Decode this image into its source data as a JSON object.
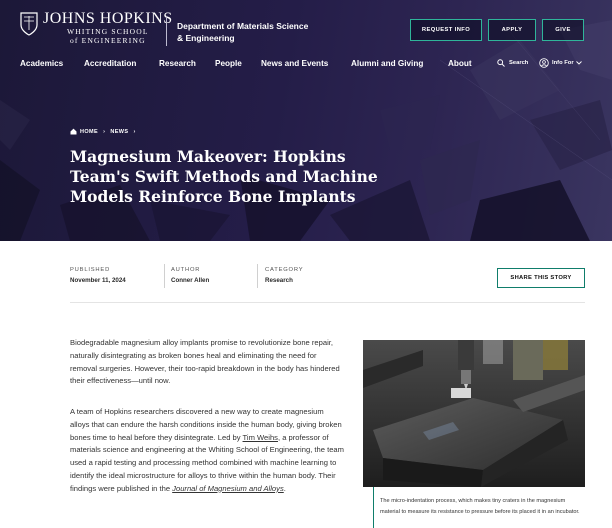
{
  "header": {
    "logo_main": "JOHNS HOPKINS",
    "logo_sub1": "WHITING SCHOOL",
    "logo_sub2": "of ENGINEERING",
    "dept_line1": "Department of Materials Science",
    "dept_line2": "& Engineering",
    "buttons": {
      "request": "REQUEST INFO",
      "apply": "APPLY",
      "give": "GIVE"
    }
  },
  "nav": {
    "items": [
      "Academics",
      "Accreditation",
      "Research",
      "People",
      "News and Events",
      "Alumni and Giving",
      "About"
    ],
    "search": "Search",
    "info_for": "Info For"
  },
  "breadcrumb": {
    "home": "HOME",
    "news": "NEWS"
  },
  "article": {
    "title": "Magnesium Makeover: Hopkins Team's Swift Methods and Machine Models Reinforce Bone Implants",
    "meta": {
      "published_label": "PUBLISHED",
      "published_value": "November 11, 2024",
      "author_label": "AUTHOR",
      "author_value": "Conner Allen",
      "category_label": "CATEGORY",
      "category_value": "Research"
    },
    "share": "SHARE THIS STORY",
    "para1": "Biodegradable magnesium alloy implants promise to revolutionize bone repair, naturally disintegrating as broken bones heal and eliminating the need for removal surgeries. However, their too-rapid breakdown in the body has hindered their effectiveness—until now.",
    "para2_a": "A team of Hopkins researchers discovered a new way to create magnesium alloys that can endure the harsh conditions inside the human body, giving broken bones time to heal before they disintegrate. Led by ",
    "para2_link": "Tim Weihs",
    "para2_b": ", a professor of materials science and engineering at the Whiting School of Engineering, the team used a rapid testing and processing method combined with machine learning to identify the ideal microstructure for alloys to thrive within the human body.  Their findings were published in the ",
    "para2_journal": "Journal of Magnesium and Alloys",
    "para2_end": ".",
    "caption": "The micro-indentation process, which makes tiny craters in the magnesium material to measure its resistance to pressure before its placed it in an incubator."
  },
  "colors": {
    "hero": "#241d48",
    "accent": "#0f7d6b",
    "button_border": "#2fb59a"
  },
  "icons": {
    "shield": "jhu-shield-icon",
    "search": "search-icon",
    "info": "person-icon",
    "home": "home-icon",
    "chevron": "chevron-down-icon"
  }
}
